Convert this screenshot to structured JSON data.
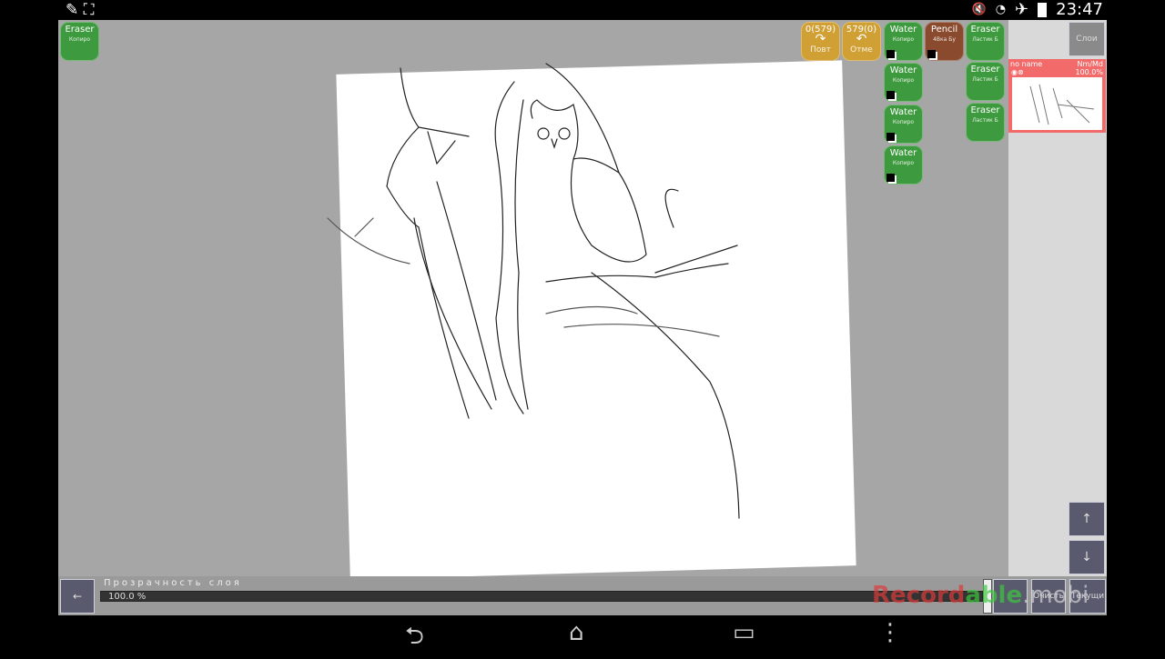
{
  "status_bar": {
    "time": "23:47",
    "left_icons": [
      "pencil-icon",
      "fullscreen-icon"
    ],
    "right_icons": [
      "mute-icon",
      "wifi-icon",
      "airplane-icon",
      "battery-icon"
    ]
  },
  "left_tool": {
    "name": "Eraser",
    "sub": "Копиро"
  },
  "history": [
    {
      "count": "0(579)",
      "label": "Повт"
    },
    {
      "count": "579(0)",
      "label": "Отме"
    }
  ],
  "water_tools": [
    {
      "name": "Water",
      "sub": "Копиро"
    },
    {
      "name": "Water",
      "sub": "Копиро"
    },
    {
      "name": "Water",
      "sub": "Копиро"
    },
    {
      "name": "Water",
      "sub": "Копиро"
    }
  ],
  "pencil_tool": {
    "name": "Pencil",
    "sub": "4Bка Бу"
  },
  "eraser_tools": [
    {
      "name": "Eraser",
      "sub": "Ластик Б"
    },
    {
      "name": "Eraser",
      "sub": "Ластик Б"
    },
    {
      "name": "Eraser",
      "sub": "Ластик Б"
    }
  ],
  "layers_button": "Слои",
  "layer": {
    "name": "no name",
    "mode": "Nm/Md",
    "opacity": "100.0%"
  },
  "bottom": {
    "back": "←",
    "opacity_label": "Прозрачность слоя",
    "opacity_value": "100.0 %",
    "btn1": "",
    "btn2": "Очисть",
    "btn3": "Текущи",
    "up": "↑",
    "down": "↓"
  },
  "watermark": {
    "a": "Record",
    "b": "able",
    ".c": ".mobi"
  },
  "nav": {
    "back": "⮌",
    "home": "⌂",
    "recent": "▭",
    "menu": "⋮"
  }
}
